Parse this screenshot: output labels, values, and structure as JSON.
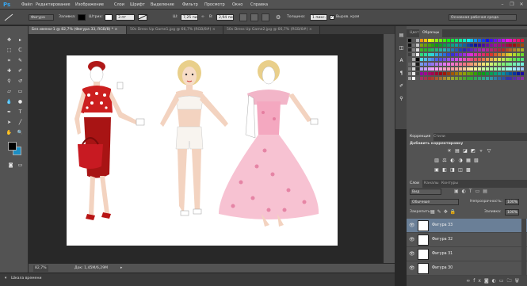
{
  "menubar": {
    "logo": "Ps",
    "items": [
      "Файл",
      "Редактирование",
      "Изображение",
      "Слои",
      "Шрифт",
      "Выделение",
      "Фильтр",
      "Просмотр",
      "Окно",
      "Справка"
    ],
    "window_buttons": [
      "–",
      "❐",
      "✕"
    ]
  },
  "options": {
    "tool_mode": "Фигура",
    "fill_label": "Заливка:",
    "stroke_label": "Штрих:",
    "stroke_width": "3 пт",
    "w_label": "Ш:",
    "w_value": "7,25 пи",
    "link": "∞",
    "h_label": "В:",
    "h_value": "2,94 пи",
    "thickness_label": "Толщина:",
    "thickness_value": "1 пикс.",
    "align_edges_label": "Выров. края",
    "workspace": "Основная рабочая среда",
    "fill_color": "#000000",
    "stroke_color": "#ffffff"
  },
  "tabs": [
    {
      "label": "Без имени-1 @ 82,7% (Фигура 33, RGB/8) *",
      "active": true
    },
    {
      "label": "50s Dress Up Game1.jpg @ 66,7% (RGB/8#)",
      "active": false
    },
    {
      "label": "50s Dress Up Game2.jpg @ 66,7% (RGB/8#)",
      "active": false
    }
  ],
  "tab_close": "×",
  "toolbox": {
    "tools": [
      "move",
      "marquee",
      "lasso",
      "quick-select",
      "crop",
      "eyedropper",
      "healing",
      "brush",
      "clone",
      "history-brush",
      "eraser",
      "gradient",
      "blur",
      "dodge",
      "pen",
      "type",
      "path-select",
      "shape",
      "hand",
      "zoom"
    ],
    "fg_color": "#000000",
    "bg_color": "#1c8fc4"
  },
  "status": {
    "zoom": "82,7%",
    "doc": "Док: 1,45M/6,29M",
    "arrow": "▸"
  },
  "timeline": {
    "label": "Шкала времени",
    "arrow": "▾"
  },
  "swatches_panel": {
    "tabs": [
      "Цвет",
      "Образцы"
    ],
    "active": 1
  },
  "adjustments_panel": {
    "tabs": [
      "Коррекция",
      "Стили"
    ],
    "active": 0,
    "subtitle": "Добавить корректировку",
    "icons_row1": [
      "☀",
      "▤",
      "◪",
      "◩",
      "▿",
      "▽"
    ],
    "icons_row2": [
      "▥",
      "⚖",
      "◐",
      "◑",
      "▦",
      "▧"
    ],
    "icons_row3": [
      "▣",
      "◧",
      "◨",
      "◫",
      "▩"
    ]
  },
  "layers_panel": {
    "tabs": [
      "Слои",
      "Каналы",
      "Контуры"
    ],
    "active": 0,
    "kind_filter": "Вид",
    "blend_mode": "Обычные",
    "opacity_label": "Непрозрачность:",
    "opacity_value": "100%",
    "lock_label": "Закрепить:",
    "fill_label": "Заливка:",
    "fill_value": "100%",
    "layers": [
      {
        "name": "Фигура 33",
        "selected": true
      },
      {
        "name": "Фигура 32",
        "selected": false
      },
      {
        "name": "Фигура 31",
        "selected": false
      },
      {
        "name": "Фигура 30",
        "selected": false
      }
    ]
  }
}
